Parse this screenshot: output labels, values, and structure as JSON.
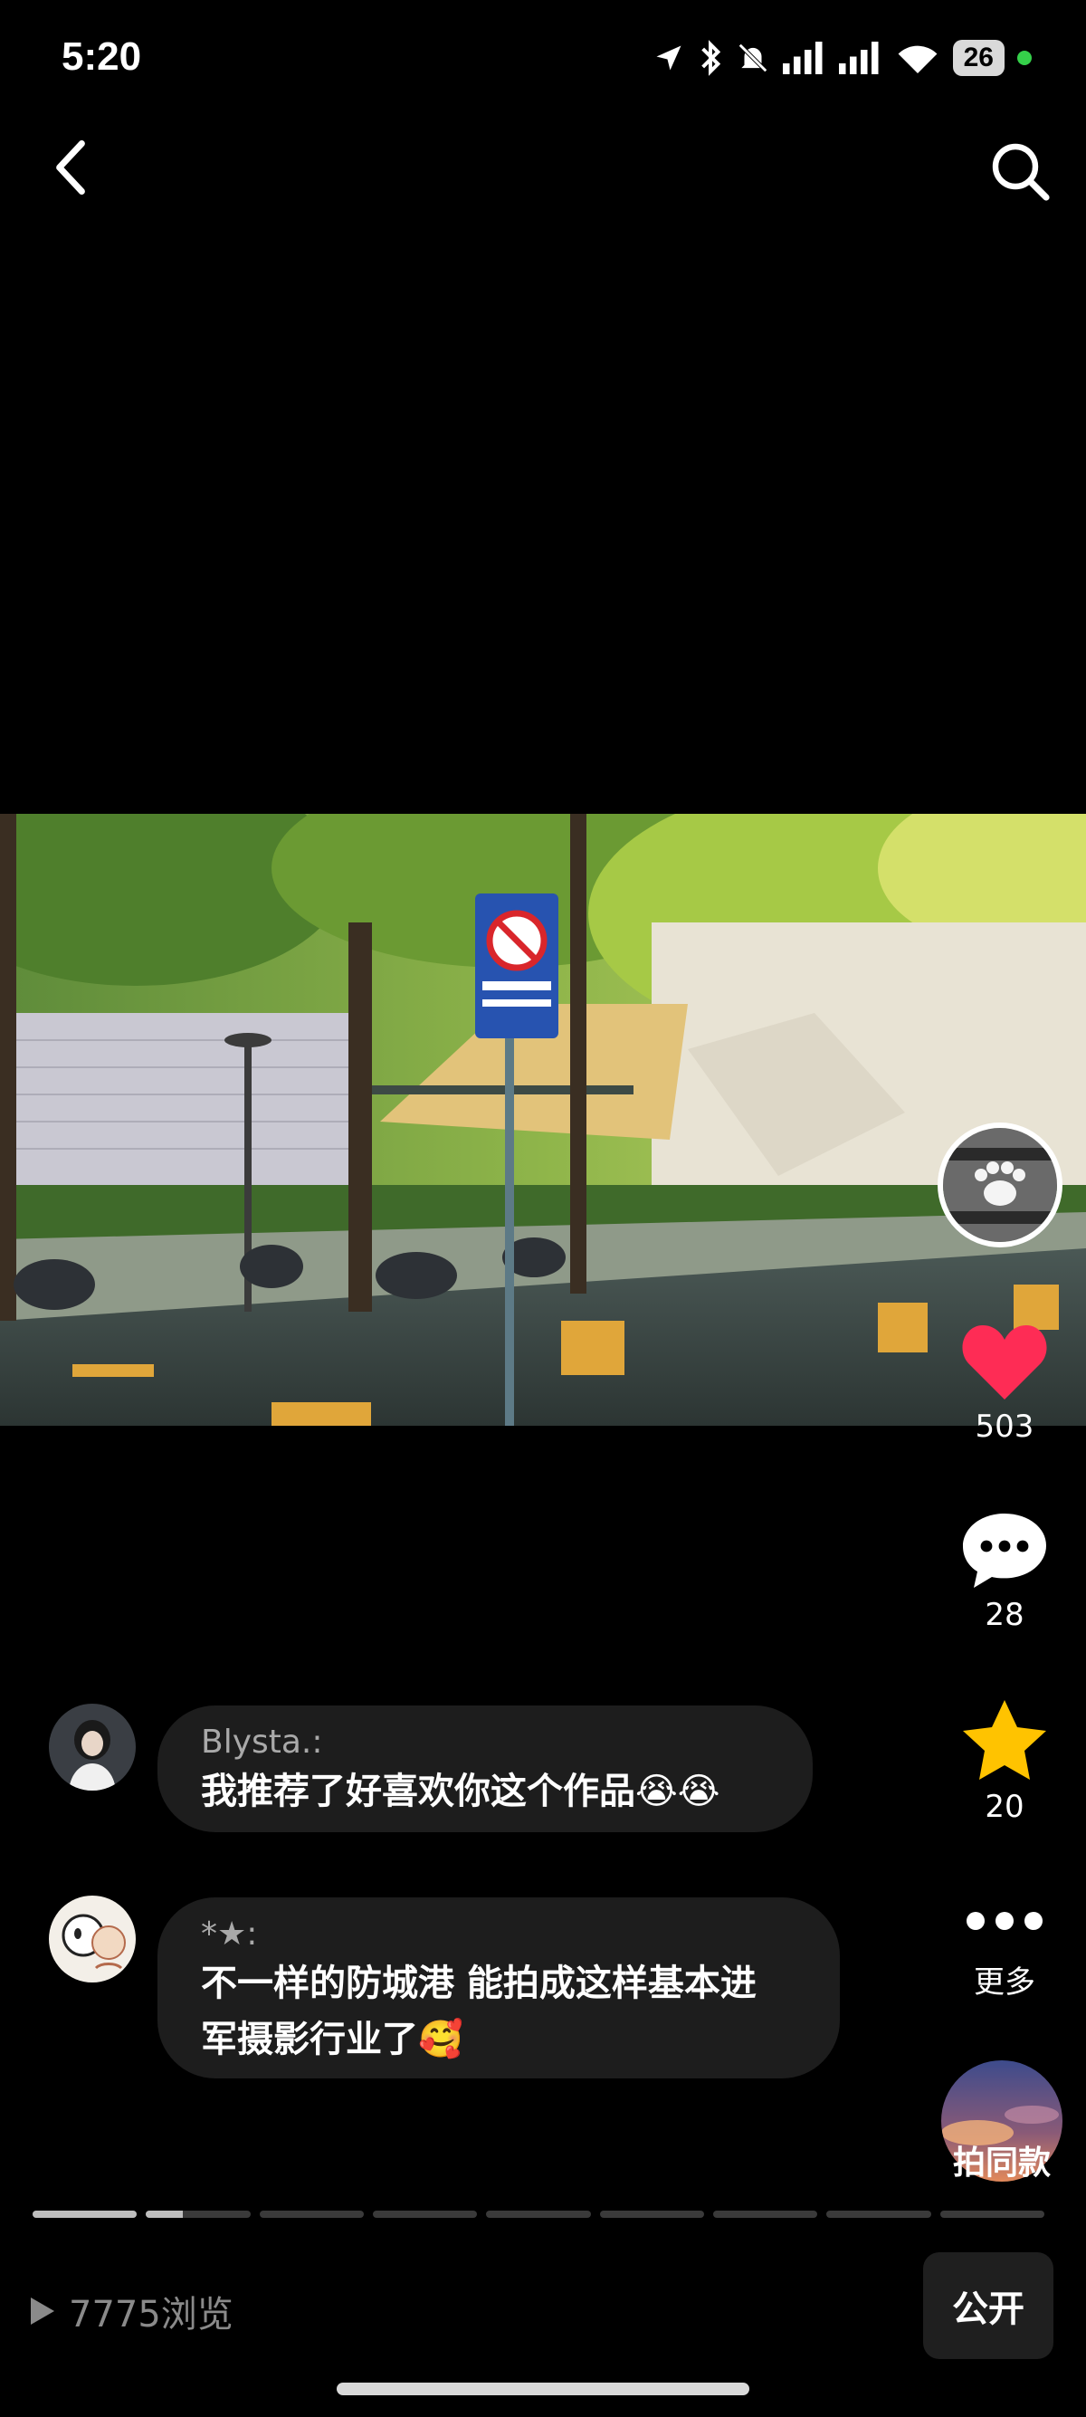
{
  "status_bar": {
    "time": "5:20",
    "battery": "26"
  },
  "actions": {
    "like_count": "503",
    "comment_count": "28",
    "favorite_count": "20",
    "more_label": "更多",
    "same_style_label": "拍同款"
  },
  "comments": [
    {
      "user": "Blysta.:",
      "text": "我推荐了好喜欢你这个作品😭😭"
    },
    {
      "user": "*★:",
      "text": "不一样的防城港 能拍成这样基本进\n军摄影行业了🥰"
    }
  ],
  "progress": {
    "segments": 9,
    "current_segment": 2,
    "current_fill": 0.35
  },
  "footer": {
    "views_text": "7775浏览",
    "public_label": "公开"
  },
  "colors": {
    "like": "#fe2c55",
    "favorite": "#ffc300",
    "bubble": "#1d1d1d"
  }
}
